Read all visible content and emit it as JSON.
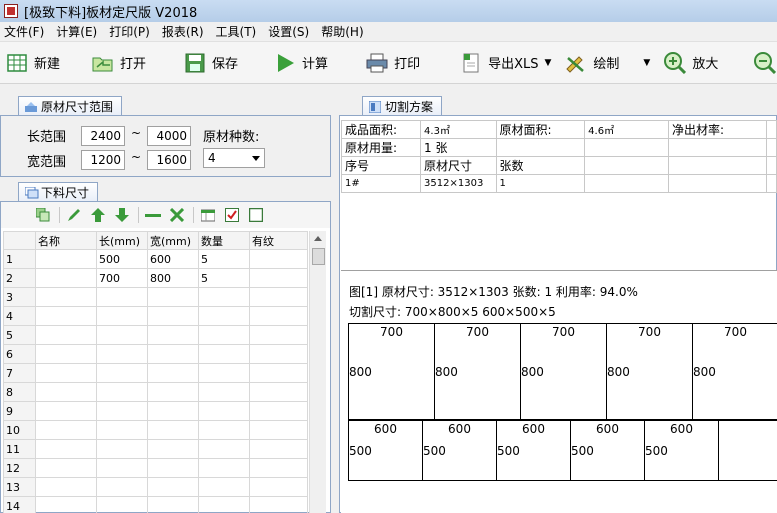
{
  "window": {
    "title": "[极致下料]板材定尺版 V2018"
  },
  "menu": [
    "文件(F)",
    "计算(E)",
    "打印(P)",
    "报表(R)",
    "工具(T)",
    "设置(S)",
    "帮助(H)"
  ],
  "toolbar": {
    "new": "新建",
    "open": "打开",
    "save": "保存",
    "calc": "计算",
    "print": "打印",
    "export": "导出XLS",
    "draw": "绘制",
    "zoom_in": "放大",
    "zoom_out": "缩小"
  },
  "range_panel": {
    "tab": "原材尺寸范围",
    "length_label": "长范围",
    "length_min": "2400",
    "length_max": "4000",
    "width_label": "宽范围",
    "width_min": "1200",
    "width_max": "1600",
    "tilde": "~",
    "kinds_label": "原材种数:",
    "kinds_value": "4"
  },
  "parts_panel": {
    "tab": "下料尺寸",
    "columns": [
      "名称",
      "长(mm)",
      "宽(mm)",
      "数量",
      "有纹"
    ],
    "rows": [
      {
        "no": "1",
        "name": "",
        "length": "500",
        "width": "600",
        "qty": "5",
        "grain": ""
      },
      {
        "no": "2",
        "name": "",
        "length": "700",
        "width": "800",
        "qty": "5",
        "grain": ""
      },
      {
        "no": "3",
        "name": "",
        "length": "",
        "width": "",
        "qty": "",
        "grain": ""
      },
      {
        "no": "4",
        "name": "",
        "length": "",
        "width": "",
        "qty": "",
        "grain": ""
      },
      {
        "no": "5",
        "name": "",
        "length": "",
        "width": "",
        "qty": "",
        "grain": ""
      },
      {
        "no": "6",
        "name": "",
        "length": "",
        "width": "",
        "qty": "",
        "grain": ""
      },
      {
        "no": "7",
        "name": "",
        "length": "",
        "width": "",
        "qty": "",
        "grain": ""
      },
      {
        "no": "8",
        "name": "",
        "length": "",
        "width": "",
        "qty": "",
        "grain": ""
      },
      {
        "no": "9",
        "name": "",
        "length": "",
        "width": "",
        "qty": "",
        "grain": ""
      },
      {
        "no": "10",
        "name": "",
        "length": "",
        "width": "",
        "qty": "",
        "grain": ""
      },
      {
        "no": "11",
        "name": "",
        "length": "",
        "width": "",
        "qty": "",
        "grain": ""
      },
      {
        "no": "12",
        "name": "",
        "length": "",
        "width": "",
        "qty": "",
        "grain": ""
      },
      {
        "no": "13",
        "name": "",
        "length": "",
        "width": "",
        "qty": "",
        "grain": ""
      },
      {
        "no": "14",
        "name": "",
        "length": "",
        "width": "",
        "qty": "",
        "grain": ""
      }
    ]
  },
  "plan_panel": {
    "tab": "切割方案",
    "product_area_label": "成品面积:",
    "product_area": "4.3㎡",
    "raw_area_label": "原材面积:",
    "raw_area": "4.6㎡",
    "net_rate_label": "净出材率:",
    "raw_usage_label": "原材用量:",
    "raw_usage": "1 张",
    "col_no": "序号",
    "col_size": "原材尺寸",
    "col_count": "张数",
    "row_no": "1#",
    "row_size": "3512×1303",
    "row_count": "1"
  },
  "drawing": {
    "info_line1": "图[1] 原材尺寸: 3512×1303  张数: 1  利用率: 94.0%",
    "info_line2": "切割尺寸: 700×800×5  600×500×5",
    "pieces_row1": [
      {
        "w": "700",
        "h": "800"
      },
      {
        "w": "700",
        "h": "800"
      },
      {
        "w": "700",
        "h": "800"
      },
      {
        "w": "700",
        "h": "800"
      },
      {
        "w": "700",
        "h": "800"
      }
    ],
    "pieces_row2": [
      {
        "w": "600",
        "h": "500"
      },
      {
        "w": "600",
        "h": "500"
      },
      {
        "w": "600",
        "h": "500"
      },
      {
        "w": "600",
        "h": "500"
      },
      {
        "w": "600",
        "h": "500"
      }
    ]
  }
}
